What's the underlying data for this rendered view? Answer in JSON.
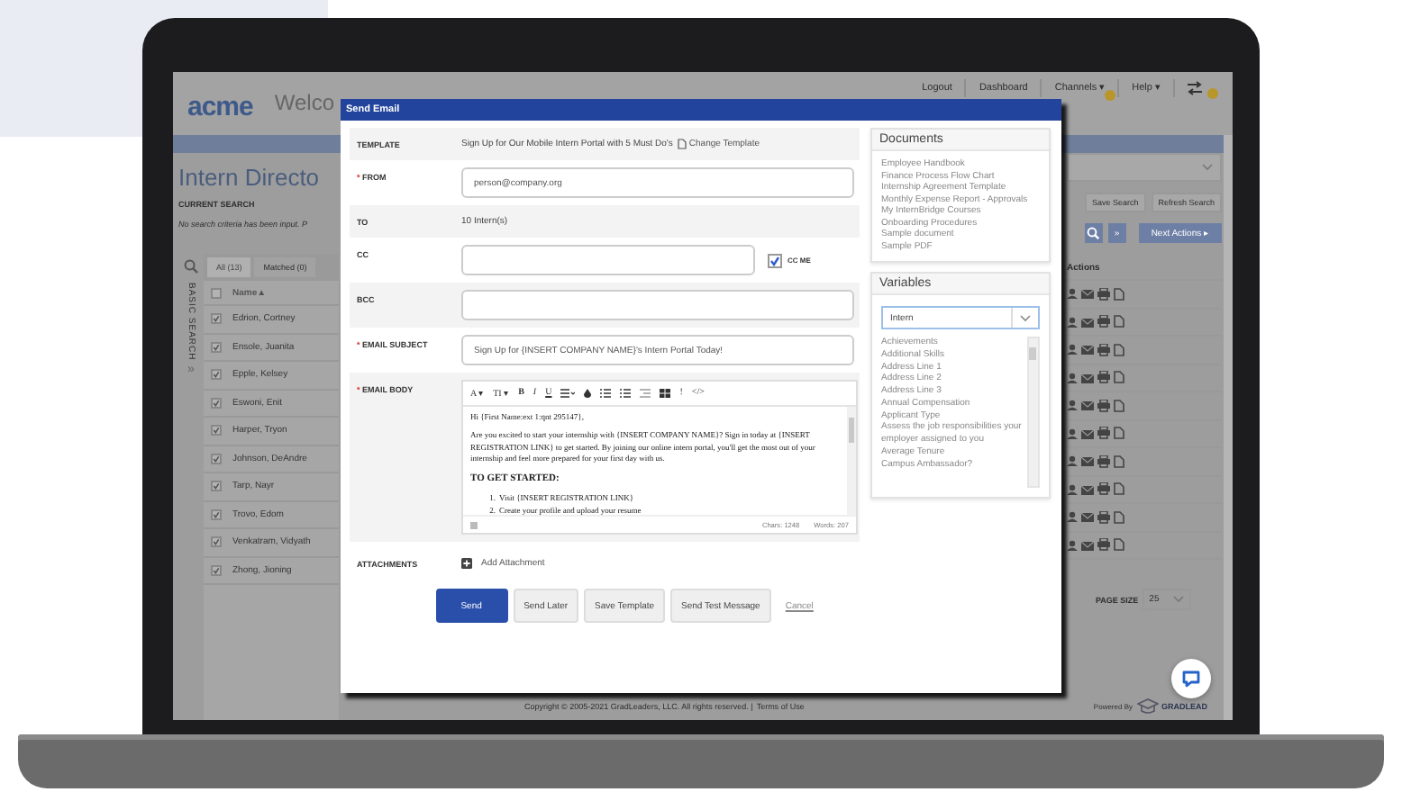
{
  "app": {
    "logo": "acme",
    "welcome": "Welco",
    "nav": [
      {
        "label": "Logout",
        "badge": false
      },
      {
        "label": "Dashboard",
        "badge": false
      },
      {
        "label": "Channels ▾",
        "badge": true
      },
      {
        "label": "Help ▾",
        "badge": false
      }
    ],
    "alerts_badge": true,
    "page_title": "Intern Directo",
    "current_search_label": "CURRENT SEARCH",
    "current_search_text": "No search criteria has been input. P",
    "side_tab": "BASIC SEARCH",
    "expand": "»",
    "tabs": [
      {
        "label": "All (13)",
        "selected": true
      },
      {
        "label": "Matched (0)",
        "selected": false
      }
    ],
    "name_column": "Name▲",
    "header_checked": false,
    "rows": [
      {
        "name": "Edrion, Cortney",
        "checked": true
      },
      {
        "name": "Ensole, Juanita",
        "checked": true
      },
      {
        "name": "Epple, Kelsey",
        "checked": true
      },
      {
        "name": "Eswoni, Enit",
        "checked": true
      },
      {
        "name": "Harper, Tryon",
        "checked": true
      },
      {
        "name": "Johnson, DeAndre",
        "checked": true
      },
      {
        "name": "Tarp, Nayr",
        "checked": true
      },
      {
        "name": "Trovo, Edom",
        "checked": true
      },
      {
        "name": "Venkatram, Vidyath",
        "checked": true
      },
      {
        "name": "Zhong, Jioning",
        "checked": true
      }
    ],
    "save_search": "Save Search",
    "refresh_search": "Refresh Search",
    "search_expand": "»",
    "next_actions": "Next Actions ▸",
    "actions_column": "Actions",
    "page_size_label": "PAGE SIZE",
    "page_size": "25",
    "copyright": "Copyright © 2005-2021 GradLeaders, LLC. All rights reserved. |",
    "terms_link": "Terms of Use",
    "powered_by": "Powered By",
    "powered_logo": "GRADLEAD"
  },
  "modal": {
    "title": "Send Email",
    "fields": [
      {
        "kind": "text",
        "label": "TEMPLATE",
        "value": "Sign Up for Our Mobile Intern Portal with 5 Must Do's",
        "link": "Change Template"
      },
      {
        "kind": "input",
        "label": "FROM",
        "mark": "*",
        "value": "person@company.org"
      },
      {
        "kind": "text",
        "label": "TO",
        "value": "10 Intern(s)"
      },
      {
        "kind": "input",
        "label": "CC",
        "checkbox": {
          "label": "CC ME",
          "checked": true
        }
      },
      {
        "kind": "input",
        "label": "BCC"
      },
      {
        "kind": "input",
        "label": "EMAIL SUBJECT",
        "mark": "*",
        "value": "Sign Up for {INSERT COMPANY NAME}'s Intern Portal Today!"
      },
      {
        "kind": "editor",
        "label": "EMAIL BODY",
        "mark": "*",
        "toolbar_left": [
          "A ▾",
          "TI ▾",
          "B",
          "I",
          "U"
        ],
        "toolbar_right": [
          "!",
          "</>"
        ],
        "greeting": "Hi {First Name:ext 1:qnt 295147},",
        "paragraph": "Are you excited to start your internship with {INSERT COMPANY NAME}? Sign in today at {INSERT REGISTRATION LINK} to get started. By joining our online intern portal, you'll get the most out of your internship and feel more prepared for your first day with us.",
        "heading": "TO GET STARTED:",
        "steps": [
          {
            "marker": "1.",
            "text": "Visit {INSERT REGISTRATION LINK}"
          },
          {
            "marker": "2.",
            "text": "Create your profile and upload your resume"
          }
        ],
        "chars": "Chars: 1248",
        "words": "Words: 207"
      },
      {
        "kind": "attachment",
        "label": "ATTACHMENTS",
        "action": "Add Attachment"
      }
    ],
    "buttons": [
      {
        "label": "Send",
        "kind": "primary"
      },
      {
        "label": "Send Later",
        "kind": "default"
      },
      {
        "label": "Save Template",
        "kind": "default"
      },
      {
        "label": "Send Test Message",
        "kind": "default"
      },
      {
        "label": "Cancel",
        "kind": "link"
      }
    ],
    "documents": {
      "title": "Documents",
      "items": [
        "Employee Handbook",
        "Finance Process Flow Chart",
        "Internship Agreement Template",
        "Monthly Expense Report - Approvals",
        "My InternBridge Courses",
        "Onboarding Procedures",
        "Sample document",
        "Sample PDF"
      ]
    },
    "variables": {
      "title": "Variables",
      "select": "Intern",
      "items": [
        "Achievements",
        "Additional Skills",
        "Address Line 1",
        "Address Line 2",
        "Address Line 3",
        "Annual Compensation",
        "Applicant Type",
        "Assess the job responsibilities your employer assigned to you",
        "Average Tenure",
        "Campus Ambassador?"
      ]
    }
  }
}
